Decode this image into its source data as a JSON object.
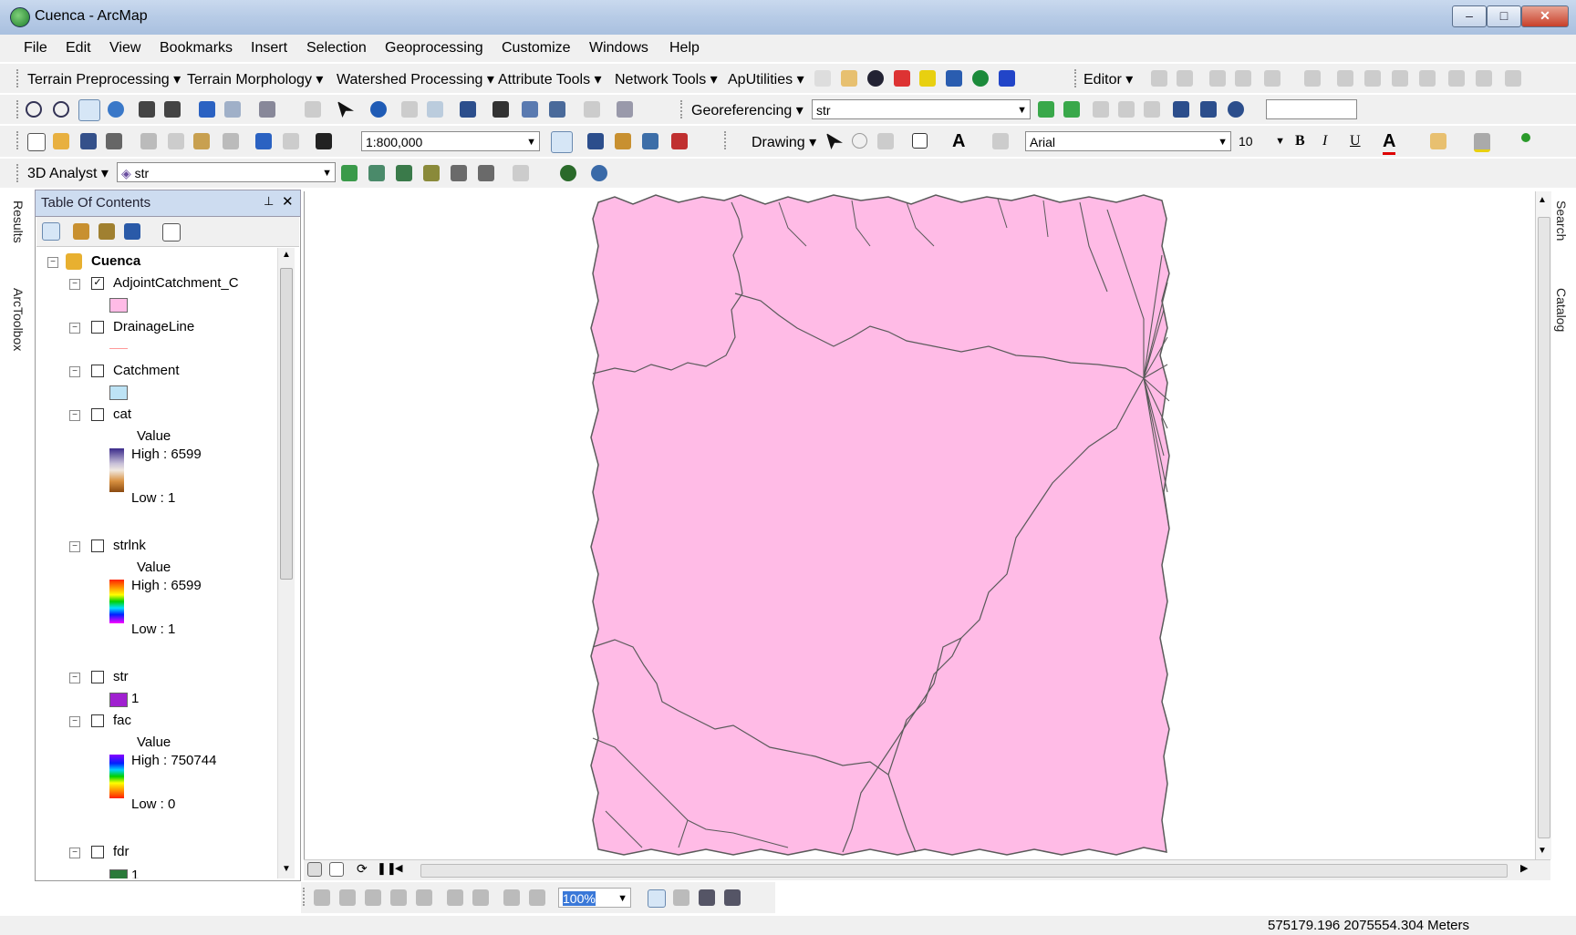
{
  "window": {
    "title": "Cuenca - ArcMap"
  },
  "menu": [
    "File",
    "Edit",
    "View",
    "Bookmarks",
    "Insert",
    "Selection",
    "Geoprocessing",
    "Customize",
    "Windows",
    "Help"
  ],
  "archydro_toolbar": {
    "items": [
      "Terrain Preprocessing",
      "Terrain Morphology",
      "Watershed Processing",
      "Attribute Tools",
      "Network Tools",
      "ApUtilities"
    ],
    "editor": "Editor"
  },
  "georef_toolbar": {
    "label": "Georeferencing",
    "layer": "str"
  },
  "standard_toolbar": {
    "scale": "1:800,000"
  },
  "drawing_toolbar": {
    "label": "Drawing",
    "font": "Arial",
    "size": "10",
    "bold": "B",
    "italic": "I",
    "underline": "U",
    "font_color": "A"
  },
  "analyst_toolbar": {
    "label": "3D Analyst",
    "layer": "str"
  },
  "toc": {
    "title": "Table Of Contents",
    "group": "Cuenca",
    "layers": {
      "adjoint": {
        "name": "AdjointCatchment_C",
        "checked": true,
        "color": "#ffbbe6"
      },
      "drainage": {
        "name": "DrainageLine",
        "color": "#ff9999"
      },
      "catchment": {
        "name": "Catchment",
        "color": "#bde3f5"
      },
      "cat": {
        "name": "cat",
        "value_label": "Value",
        "high": "High : 6599",
        "low": "Low : 1"
      },
      "strlnk": {
        "name": "strlnk",
        "value_label": "Value",
        "high": "High : 6599",
        "low": "Low : 1"
      },
      "str": {
        "name": "str",
        "class_label": "1",
        "color": "#a020d0"
      },
      "fac": {
        "name": "fac",
        "value_label": "Value",
        "high": "High : 750744",
        "low": "Low : 0"
      },
      "fdr": {
        "name": "fdr",
        "class_label": "1"
      }
    }
  },
  "side_tabs": {
    "left": [
      "Results",
      "ArcToolbox"
    ],
    "right": [
      "Search",
      "Catalog"
    ]
  },
  "layout_toolbar": {
    "zoom": "100%"
  },
  "status": {
    "coordinates": "575179.196  2075554.304 Meters"
  },
  "map": {
    "fill": "#ffbbe6",
    "stroke": "#5a5a5a"
  }
}
